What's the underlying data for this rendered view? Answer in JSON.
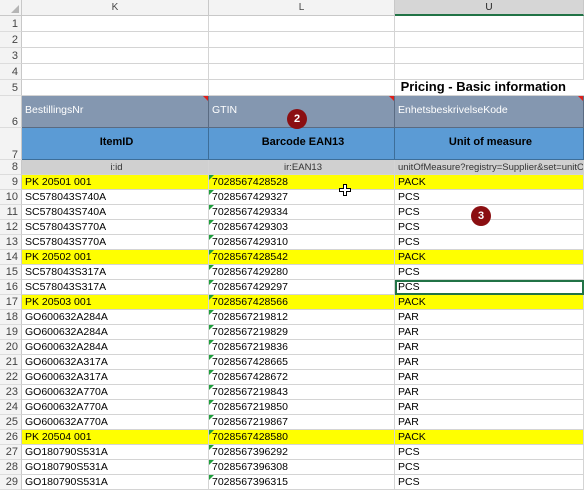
{
  "columns": [
    "K",
    "L",
    "U"
  ],
  "title": "Pricing - Basic information",
  "row6": [
    "BestillingsNr",
    "GTIN",
    "EnhetsbeskrivelseKode"
  ],
  "row7": [
    "ItemID",
    "Barcode EAN13",
    "Unit of measure"
  ],
  "row8": [
    "i:id",
    "ir:EAN13",
    "unitOfMeasure?registry=Supplier&set=unitOfM"
  ],
  "empty_rows": [
    "1",
    "2",
    "3",
    "4"
  ],
  "row_numbers": {
    "r5": "5",
    "r6": "6",
    "r7": "7",
    "r8": "8"
  },
  "data_rows": [
    {
      "num": "9",
      "item": "PK 20501 001",
      "ean": "7028567428528",
      "unit": "PACK",
      "highlight": true
    },
    {
      "num": "10",
      "item": "SC578043S740A",
      "ean": "7028567429327",
      "unit": "PCS",
      "highlight": false
    },
    {
      "num": "11",
      "item": "SC578043S740A",
      "ean": "7028567429334",
      "unit": "PCS",
      "highlight": false
    },
    {
      "num": "12",
      "item": "SC578043S770A",
      "ean": "7028567429303",
      "unit": "PCS",
      "highlight": false
    },
    {
      "num": "13",
      "item": "SC578043S770A",
      "ean": "7028567429310",
      "unit": "PCS",
      "highlight": false
    },
    {
      "num": "14",
      "item": "PK 20502 001",
      "ean": "7028567428542",
      "unit": "PACK",
      "highlight": true
    },
    {
      "num": "15",
      "item": "SC578043S317A",
      "ean": "7028567429280",
      "unit": "PCS",
      "highlight": false
    },
    {
      "num": "16",
      "item": "SC578043S317A",
      "ean": "7028567429297",
      "unit": "PCS",
      "highlight": false
    },
    {
      "num": "17",
      "item": "PK 20503 001",
      "ean": "7028567428566",
      "unit": "PACK",
      "highlight": true
    },
    {
      "num": "18",
      "item": "GO600632A284A",
      "ean": "7028567219812",
      "unit": "PAR",
      "highlight": false
    },
    {
      "num": "19",
      "item": "GO600632A284A",
      "ean": "7028567219829",
      "unit": "PAR",
      "highlight": false
    },
    {
      "num": "20",
      "item": "GO600632A284A",
      "ean": "7028567219836",
      "unit": "PAR",
      "highlight": false
    },
    {
      "num": "21",
      "item": "GO600632A317A",
      "ean": "7028567428665",
      "unit": "PAR",
      "highlight": false
    },
    {
      "num": "22",
      "item": "GO600632A317A",
      "ean": "7028567428672",
      "unit": "PAR",
      "highlight": false
    },
    {
      "num": "23",
      "item": "GO600632A770A",
      "ean": "7028567219843",
      "unit": "PAR",
      "highlight": false
    },
    {
      "num": "24",
      "item": "GO600632A770A",
      "ean": "7028567219850",
      "unit": "PAR",
      "highlight": false
    },
    {
      "num": "25",
      "item": "GO600632A770A",
      "ean": "7028567219867",
      "unit": "PAR",
      "highlight": false
    },
    {
      "num": "26",
      "item": "PK 20504 001",
      "ean": "7028567428580",
      "unit": "PACK",
      "highlight": true
    },
    {
      "num": "27",
      "item": "GO180790S531A",
      "ean": "7028567396292",
      "unit": "PCS",
      "highlight": false
    },
    {
      "num": "28",
      "item": "GO180790S531A",
      "ean": "7028567396308",
      "unit": "PCS",
      "highlight": false
    },
    {
      "num": "29",
      "item": "GO180790S531A",
      "ean": "7028567396315",
      "unit": "PCS",
      "highlight": false
    }
  ],
  "badges": [
    "2",
    "3"
  ],
  "colors": {
    "yellow": "#ffff00",
    "header_blue": "#5b9bd5",
    "header_navy": "#8497b0",
    "badge": "#8b0f12"
  }
}
